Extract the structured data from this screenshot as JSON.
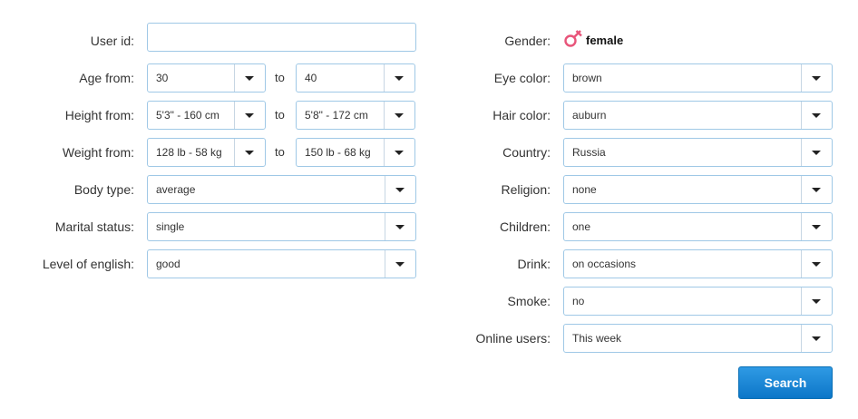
{
  "left": {
    "user_id": {
      "label": "User id:",
      "value": ""
    },
    "age": {
      "label": "Age from:",
      "from": "30",
      "to_label": "to",
      "to": "40"
    },
    "height": {
      "label": "Height from:",
      "from": "5'3\" - 160 cm",
      "to_label": "to",
      "to": "5'8\" - 172 cm"
    },
    "weight": {
      "label": "Weight from:",
      "from": "128 lb - 58 kg",
      "to_label": "to",
      "to": "150 lb - 68 kg"
    },
    "body_type": {
      "label": "Body type:",
      "value": "average"
    },
    "marital_status": {
      "label": "Marital status:",
      "value": "single"
    },
    "english": {
      "label": "Level of english:",
      "value": "good"
    }
  },
  "right": {
    "gender": {
      "label": "Gender:",
      "value": "female",
      "icon": "female-gender-icon",
      "icon_color": "#e8557a"
    },
    "eye_color": {
      "label": "Eye color:",
      "value": "brown"
    },
    "hair_color": {
      "label": "Hair color:",
      "value": "auburn"
    },
    "country": {
      "label": "Country:",
      "value": "Russia"
    },
    "religion": {
      "label": "Religion:",
      "value": "none"
    },
    "children": {
      "label": "Children:",
      "value": "one"
    },
    "drink": {
      "label": "Drink:",
      "value": "on occasions"
    },
    "smoke": {
      "label": "Smoke:",
      "value": "no"
    },
    "online_users": {
      "label": "Online users:",
      "value": "This week"
    }
  },
  "search_button": {
    "label": "Search",
    "color": "#1a86d6"
  }
}
